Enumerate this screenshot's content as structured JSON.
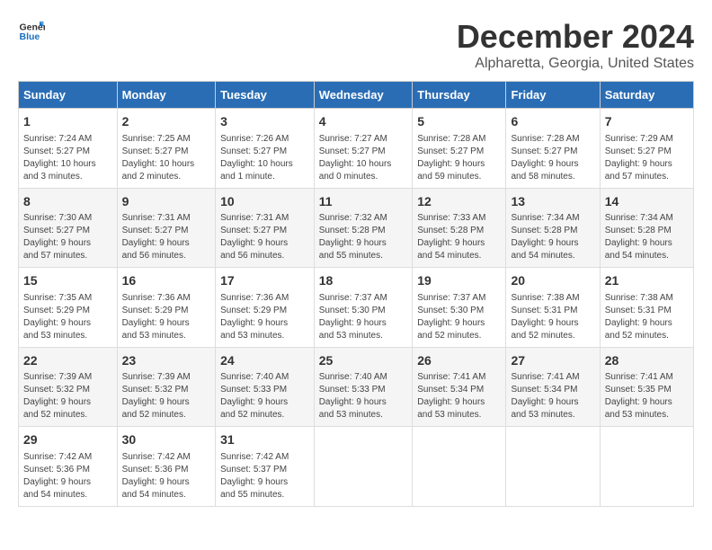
{
  "logo": {
    "general": "General",
    "blue": "Blue"
  },
  "title": "December 2024",
  "subtitle": "Alpharetta, Georgia, United States",
  "days_header": [
    "Sunday",
    "Monday",
    "Tuesday",
    "Wednesday",
    "Thursday",
    "Friday",
    "Saturday"
  ],
  "weeks": [
    [
      {
        "day": "1",
        "info": "Sunrise: 7:24 AM\nSunset: 5:27 PM\nDaylight: 10 hours\nand 3 minutes."
      },
      {
        "day": "2",
        "info": "Sunrise: 7:25 AM\nSunset: 5:27 PM\nDaylight: 10 hours\nand 2 minutes."
      },
      {
        "day": "3",
        "info": "Sunrise: 7:26 AM\nSunset: 5:27 PM\nDaylight: 10 hours\nand 1 minute."
      },
      {
        "day": "4",
        "info": "Sunrise: 7:27 AM\nSunset: 5:27 PM\nDaylight: 10 hours\nand 0 minutes."
      },
      {
        "day": "5",
        "info": "Sunrise: 7:28 AM\nSunset: 5:27 PM\nDaylight: 9 hours\nand 59 minutes."
      },
      {
        "day": "6",
        "info": "Sunrise: 7:28 AM\nSunset: 5:27 PM\nDaylight: 9 hours\nand 58 minutes."
      },
      {
        "day": "7",
        "info": "Sunrise: 7:29 AM\nSunset: 5:27 PM\nDaylight: 9 hours\nand 57 minutes."
      }
    ],
    [
      {
        "day": "8",
        "info": "Sunrise: 7:30 AM\nSunset: 5:27 PM\nDaylight: 9 hours\nand 57 minutes."
      },
      {
        "day": "9",
        "info": "Sunrise: 7:31 AM\nSunset: 5:27 PM\nDaylight: 9 hours\nand 56 minutes."
      },
      {
        "day": "10",
        "info": "Sunrise: 7:31 AM\nSunset: 5:27 PM\nDaylight: 9 hours\nand 56 minutes."
      },
      {
        "day": "11",
        "info": "Sunrise: 7:32 AM\nSunset: 5:28 PM\nDaylight: 9 hours\nand 55 minutes."
      },
      {
        "day": "12",
        "info": "Sunrise: 7:33 AM\nSunset: 5:28 PM\nDaylight: 9 hours\nand 54 minutes."
      },
      {
        "day": "13",
        "info": "Sunrise: 7:34 AM\nSunset: 5:28 PM\nDaylight: 9 hours\nand 54 minutes."
      },
      {
        "day": "14",
        "info": "Sunrise: 7:34 AM\nSunset: 5:28 PM\nDaylight: 9 hours\nand 54 minutes."
      }
    ],
    [
      {
        "day": "15",
        "info": "Sunrise: 7:35 AM\nSunset: 5:29 PM\nDaylight: 9 hours\nand 53 minutes."
      },
      {
        "day": "16",
        "info": "Sunrise: 7:36 AM\nSunset: 5:29 PM\nDaylight: 9 hours\nand 53 minutes."
      },
      {
        "day": "17",
        "info": "Sunrise: 7:36 AM\nSunset: 5:29 PM\nDaylight: 9 hours\nand 53 minutes."
      },
      {
        "day": "18",
        "info": "Sunrise: 7:37 AM\nSunset: 5:30 PM\nDaylight: 9 hours\nand 53 minutes."
      },
      {
        "day": "19",
        "info": "Sunrise: 7:37 AM\nSunset: 5:30 PM\nDaylight: 9 hours\nand 52 minutes."
      },
      {
        "day": "20",
        "info": "Sunrise: 7:38 AM\nSunset: 5:31 PM\nDaylight: 9 hours\nand 52 minutes."
      },
      {
        "day": "21",
        "info": "Sunrise: 7:38 AM\nSunset: 5:31 PM\nDaylight: 9 hours\nand 52 minutes."
      }
    ],
    [
      {
        "day": "22",
        "info": "Sunrise: 7:39 AM\nSunset: 5:32 PM\nDaylight: 9 hours\nand 52 minutes."
      },
      {
        "day": "23",
        "info": "Sunrise: 7:39 AM\nSunset: 5:32 PM\nDaylight: 9 hours\nand 52 minutes."
      },
      {
        "day": "24",
        "info": "Sunrise: 7:40 AM\nSunset: 5:33 PM\nDaylight: 9 hours\nand 52 minutes."
      },
      {
        "day": "25",
        "info": "Sunrise: 7:40 AM\nSunset: 5:33 PM\nDaylight: 9 hours\nand 53 minutes."
      },
      {
        "day": "26",
        "info": "Sunrise: 7:41 AM\nSunset: 5:34 PM\nDaylight: 9 hours\nand 53 minutes."
      },
      {
        "day": "27",
        "info": "Sunrise: 7:41 AM\nSunset: 5:34 PM\nDaylight: 9 hours\nand 53 minutes."
      },
      {
        "day": "28",
        "info": "Sunrise: 7:41 AM\nSunset: 5:35 PM\nDaylight: 9 hours\nand 53 minutes."
      }
    ],
    [
      {
        "day": "29",
        "info": "Sunrise: 7:42 AM\nSunset: 5:36 PM\nDaylight: 9 hours\nand 54 minutes."
      },
      {
        "day": "30",
        "info": "Sunrise: 7:42 AM\nSunset: 5:36 PM\nDaylight: 9 hours\nand 54 minutes."
      },
      {
        "day": "31",
        "info": "Sunrise: 7:42 AM\nSunset: 5:37 PM\nDaylight: 9 hours\nand 55 minutes."
      },
      {
        "day": "",
        "info": ""
      },
      {
        "day": "",
        "info": ""
      },
      {
        "day": "",
        "info": ""
      },
      {
        "day": "",
        "info": ""
      }
    ]
  ]
}
